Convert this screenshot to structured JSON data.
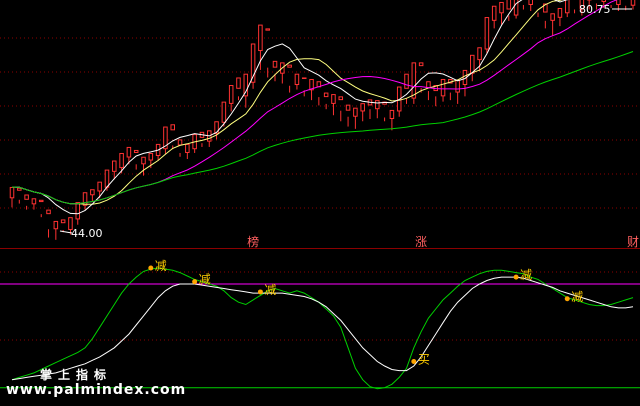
{
  "colors": {
    "background": "#000000",
    "grid": "#8b0000",
    "up_candle": "#ff3232",
    "down_candle": "#54ffff",
    "ma_yellow": "#ffff80",
    "ma_white": "#ffffff",
    "ma_magenta": "#ff00ff",
    "ma_green": "#00d000",
    "signal_dot": "#ffa500",
    "signal_text": "#ffcc00",
    "event_tag": "#ff6060",
    "indicator_line": "#ff00ff"
  },
  "chart_data": [
    {
      "type": "candlestick",
      "annotations": {
        "high_label": "80.75",
        "low_label": "44.00"
      },
      "candles": [
        [
          52.0,
          53.5,
          50.8,
          53.0
        ],
        [
          53.0,
          53.4,
          51.3,
          51.8
        ],
        [
          51.8,
          52.5,
          50.5,
          51.0
        ],
        [
          51.2,
          52.0,
          50.5,
          51.5
        ],
        [
          51.5,
          51.8,
          49.5,
          49.9
        ],
        [
          49.9,
          50.5,
          46.8,
          47.9
        ],
        [
          47.9,
          49.0,
          46.5,
          48.7
        ],
        [
          48.7,
          49.2,
          47.5,
          47.8
        ],
        [
          47.8,
          49.5,
          47.2,
          49.0
        ],
        [
          49.2,
          51.5,
          48.5,
          51.0
        ],
        [
          51.0,
          52.8,
          50.5,
          52.4
        ],
        [
          52.4,
          53.2,
          51.5,
          52.9
        ],
        [
          52.9,
          54.2,
          52.0,
          53.4
        ],
        [
          53.4,
          55.8,
          53.0,
          55.5
        ],
        [
          55.5,
          57.0,
          54.5,
          56.0
        ],
        [
          56.0,
          58.0,
          55.3,
          57.4
        ],
        [
          57.4,
          58.8,
          56.5,
          58.0
        ],
        [
          58.0,
          58.4,
          55.8,
          56.5
        ],
        [
          56.5,
          57.5,
          55.0,
          56.9
        ],
        [
          57.0,
          58.0,
          56.0,
          57.6
        ],
        [
          57.6,
          59.2,
          57.0,
          58.5
        ],
        [
          58.5,
          61.5,
          57.8,
          61.0
        ],
        [
          61.0,
          61.8,
          58.5,
          59.0
        ],
        [
          59.0,
          59.8,
          57.5,
          58.0
        ],
        [
          58.0,
          59.2,
          57.2,
          58.3
        ],
        [
          58.5,
          60.5,
          58.0,
          60.0
        ],
        [
          60.0,
          60.8,
          58.8,
          59.3
        ],
        [
          59.5,
          61.0,
          58.8,
          60.5
        ],
        [
          60.5,
          62.2,
          59.8,
          62.0
        ],
        [
          62.0,
          64.8,
          61.5,
          64.5
        ],
        [
          64.5,
          67.0,
          63.5,
          66.5
        ],
        [
          66.5,
          68.0,
          65.0,
          65.5
        ],
        [
          65.5,
          68.5,
          64.0,
          67.3
        ],
        [
          67.3,
          72.5,
          66.5,
          71.5
        ],
        [
          71.5,
          75.0,
          69.0,
          74.2
        ],
        [
          74.2,
          74.5,
          68.0,
          69.3
        ],
        [
          69.3,
          70.2,
          67.5,
          68.5
        ],
        [
          68.5,
          70.0,
          67.2,
          69.3
        ],
        [
          69.3,
          69.7,
          66.0,
          66.9
        ],
        [
          67.0,
          68.5,
          66.4,
          67.8
        ],
        [
          67.8,
          68.0,
          65.5,
          66.3
        ],
        [
          66.3,
          67.8,
          65.0,
          66.7
        ],
        [
          66.7,
          67.5,
          64.3,
          65.4
        ],
        [
          65.4,
          66.0,
          63.8,
          64.5
        ],
        [
          64.5,
          65.8,
          63.0,
          65.0
        ],
        [
          65.0,
          65.5,
          62.2,
          63.6
        ],
        [
          63.6,
          64.4,
          61.5,
          62.8
        ],
        [
          62.8,
          64.0,
          61.2,
          63.5
        ],
        [
          63.5,
          64.6,
          62.2,
          64.3
        ],
        [
          64.3,
          65.1,
          62.5,
          63.8
        ],
        [
          63.8,
          65.0,
          62.6,
          64.4
        ],
        [
          64.4,
          64.8,
          62.2,
          62.7
        ],
        [
          62.5,
          63.7,
          61.0,
          63.2
        ],
        [
          63.5,
          66.8,
          62.8,
          66.5
        ],
        [
          66.5,
          68.5,
          64.5,
          65.2
        ],
        [
          65.2,
          70.0,
          64.5,
          69.5
        ],
        [
          69.5,
          70.0,
          66.0,
          66.6
        ],
        [
          66.6,
          67.5,
          65.0,
          66.2
        ],
        [
          66.2,
          67.0,
          64.2,
          65.5
        ],
        [
          65.5,
          67.8,
          64.8,
          67.2
        ],
        [
          67.2,
          67.8,
          65.0,
          66.0
        ],
        [
          66.0,
          67.7,
          64.5,
          67.0
        ],
        [
          67.0,
          69.0,
          65.5,
          68.5
        ],
        [
          68.5,
          71.0,
          67.5,
          70.3
        ],
        [
          70.3,
          72.0,
          68.8,
          71.7
        ],
        [
          71.7,
          76.0,
          71.2,
          75.5
        ],
        [
          75.5,
          77.5,
          74.5,
          76.5
        ],
        [
          76.5,
          78.0,
          75.0,
          77.0
        ],
        [
          77.0,
          78.5,
          75.5,
          76.2
        ],
        [
          76.2,
          78.9,
          75.8,
          78.4
        ],
        [
          78.4,
          79.2,
          77.0,
          77.6
        ],
        [
          77.6,
          79.0,
          76.8,
          78.6
        ],
        [
          78.6,
          79.5,
          76.0,
          76.6
        ],
        [
          76.6,
          77.8,
          74.5,
          75.5
        ],
        [
          75.5,
          76.5,
          73.5,
          75.9
        ],
        [
          75.9,
          77.2,
          74.8,
          76.3
        ],
        [
          76.5,
          80.5,
          76.0,
          80.0
        ],
        [
          80.0,
          80.5,
          76.5,
          77.0
        ],
        [
          77.0,
          79.0,
          76.2,
          78.2
        ],
        [
          78.2,
          79.5,
          77.0,
          78.6
        ],
        [
          78.6,
          79.3,
          77.0,
          77.8
        ],
        [
          78.0,
          79.8,
          77.2,
          79.3
        ],
        [
          79.3,
          79.8,
          77.2,
          77.6
        ],
        [
          77.6,
          79.2,
          76.8,
          78.7
        ],
        [
          78.7,
          79.8,
          76.9,
          77.5
        ],
        [
          77.5,
          80.75,
          77.0,
          80.2
        ]
      ],
      "ma_series": [
        {
          "color": "#ffff80",
          "period": 10
        },
        {
          "color": "#ffffff",
          "period": 5
        },
        {
          "color": "#ff00ff",
          "period": 20
        },
        {
          "color": "#00d000",
          "period": 60
        }
      ],
      "event_tags": [
        {
          "index": 33,
          "label": "榜"
        },
        {
          "index": 56,
          "label": "涨"
        },
        {
          "index": 85,
          "label": "财"
        }
      ]
    },
    {
      "type": "line",
      "guide_level": 86,
      "series": [
        {
          "color": "#00d000",
          "values": [
            2,
            4,
            6,
            8,
            11,
            14,
            17,
            20,
            23,
            26,
            30,
            38,
            48,
            58,
            68,
            78,
            86,
            92,
            97,
            99,
            100,
            99,
            98,
            96,
            93,
            90,
            88,
            86,
            84,
            80,
            74,
            70,
            68,
            72,
            76,
            80,
            82,
            80,
            78,
            80,
            78,
            74,
            70,
            64,
            58,
            48,
            30,
            12,
            2,
            -4,
            -6,
            -5,
            -2,
            4,
            12,
            30,
            44,
            56,
            64,
            72,
            78,
            84,
            89,
            92,
            95,
            97,
            98,
            98,
            97,
            96,
            95,
            92,
            90,
            86,
            82,
            78,
            74,
            72,
            70,
            68,
            67,
            67,
            68,
            70,
            72,
            74
          ]
        },
        {
          "color": "#ffffff",
          "values": [
            2,
            3,
            4,
            5,
            6,
            7,
            8,
            10,
            12,
            14,
            16,
            19,
            22,
            26,
            30,
            36,
            42,
            50,
            58,
            66,
            74,
            80,
            84,
            86,
            86,
            86,
            85,
            84,
            83,
            82,
            81,
            80,
            79,
            78,
            78,
            78,
            78,
            78,
            77,
            76,
            75,
            73,
            70,
            66,
            60,
            54,
            46,
            38,
            30,
            24,
            18,
            14,
            11,
            10,
            10,
            14,
            22,
            32,
            42,
            52,
            62,
            70,
            76,
            82,
            86,
            89,
            91,
            92,
            92,
            92,
            91,
            89,
            87,
            85,
            83,
            80,
            78,
            76,
            74,
            72,
            70,
            68,
            66,
            65,
            65,
            66
          ]
        }
      ],
      "signals": [
        {
          "index": 19,
          "label": "减",
          "value": 100
        },
        {
          "index": 25,
          "label": "减",
          "value": 88
        },
        {
          "index": 34,
          "label": "减",
          "value": 79
        },
        {
          "index": 55,
          "label": "买",
          "value": 18
        },
        {
          "index": 69,
          "label": "减",
          "value": 92
        },
        {
          "index": 76,
          "label": "减",
          "value": 73
        }
      ]
    }
  ],
  "watermark": {
    "title": "掌上指标",
    "url": "www.palmindex.com"
  }
}
